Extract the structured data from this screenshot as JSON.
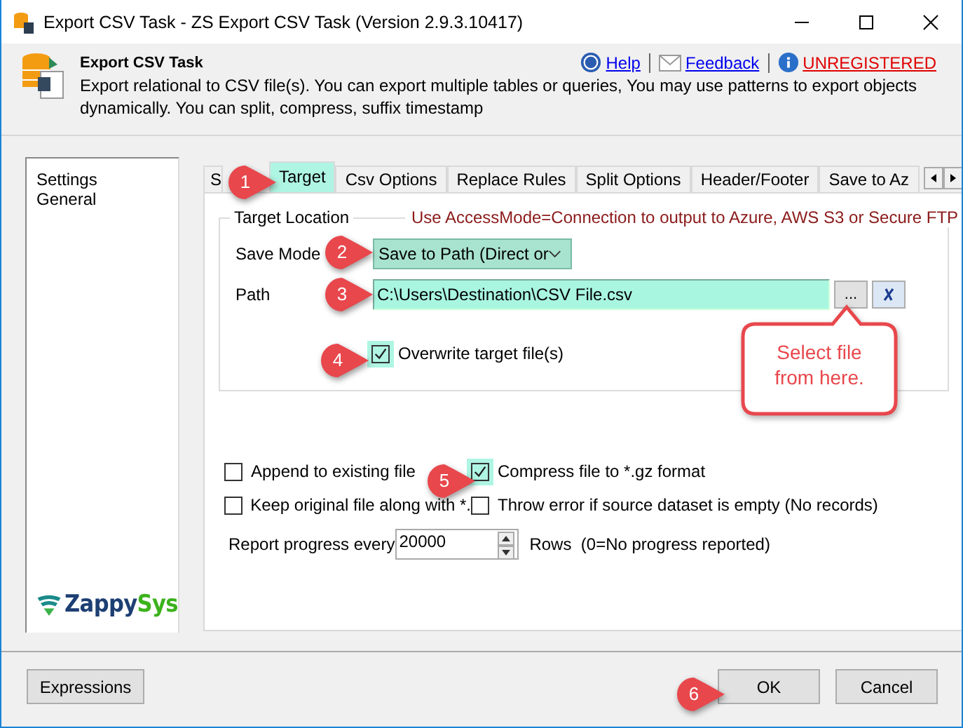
{
  "window": {
    "title": "Export CSV Task - ZS Export CSV Task (Version 2.9.3.10417)"
  },
  "header": {
    "title": "Export CSV Task",
    "description": "Export relational to CSV file(s). You can export multiple tables or queries, You may use patterns to export objects dynamically. You can split, compress, suffix timestamp",
    "links": [
      {
        "label": "Help",
        "kind": "help"
      },
      {
        "label": "Feedback",
        "kind": "feedback"
      },
      {
        "label": "UNREGISTERED",
        "kind": "info"
      }
    ]
  },
  "sidebar": {
    "items": [
      {
        "label": "Settings"
      },
      {
        "label": "General"
      }
    ],
    "logo": {
      "first": "Zappy",
      "second": "Sys"
    }
  },
  "tabs": [
    {
      "label": "S",
      "selected": false
    },
    {
      "label": "Target",
      "selected": true
    },
    {
      "label": "Csv Options",
      "selected": false
    },
    {
      "label": "Replace Rules",
      "selected": false
    },
    {
      "label": "Split Options",
      "selected": false
    },
    {
      "label": "Header/Footer",
      "selected": false
    },
    {
      "label": "Save to Az",
      "selected": false
    }
  ],
  "target_location": {
    "legend": "Target Location",
    "note": "Use AccessMode=Connection to output to Azure, AWS S3 or Secure FTP",
    "save_mode": {
      "label": "Save Mode",
      "value": "Save to Path (Direct or"
    },
    "path": {
      "label": "Path",
      "value": "C:\\Users\\Destination\\CSV File.csv",
      "browse": "..."
    },
    "overwrite": {
      "label": "Overwrite target file(s)",
      "checked": true,
      "highlighted": true
    }
  },
  "options": [
    {
      "label": "Append to existing file",
      "checked": false,
      "highlighted": false
    },
    {
      "label": "Compress file to *.gz format",
      "checked": true,
      "highlighted": true
    },
    {
      "label": "Keep original file along with *.",
      "checked": false,
      "highlighted": false
    },
    {
      "label": "Throw error if source dataset is empty (No records)",
      "checked": false,
      "highlighted": false
    }
  ],
  "progress": {
    "label": "Report progress every",
    "value": "20000",
    "suffix": "Rows  (0=No progress reported)"
  },
  "callout": "Select file from here.",
  "markers": [
    {
      "label": "1"
    },
    {
      "label": "2"
    },
    {
      "label": "3"
    },
    {
      "label": "4"
    },
    {
      "label": "5"
    },
    {
      "label": "6"
    }
  ],
  "buttons": {
    "left": "Expressions",
    "ok": "OK",
    "cancel": "Cancel"
  }
}
